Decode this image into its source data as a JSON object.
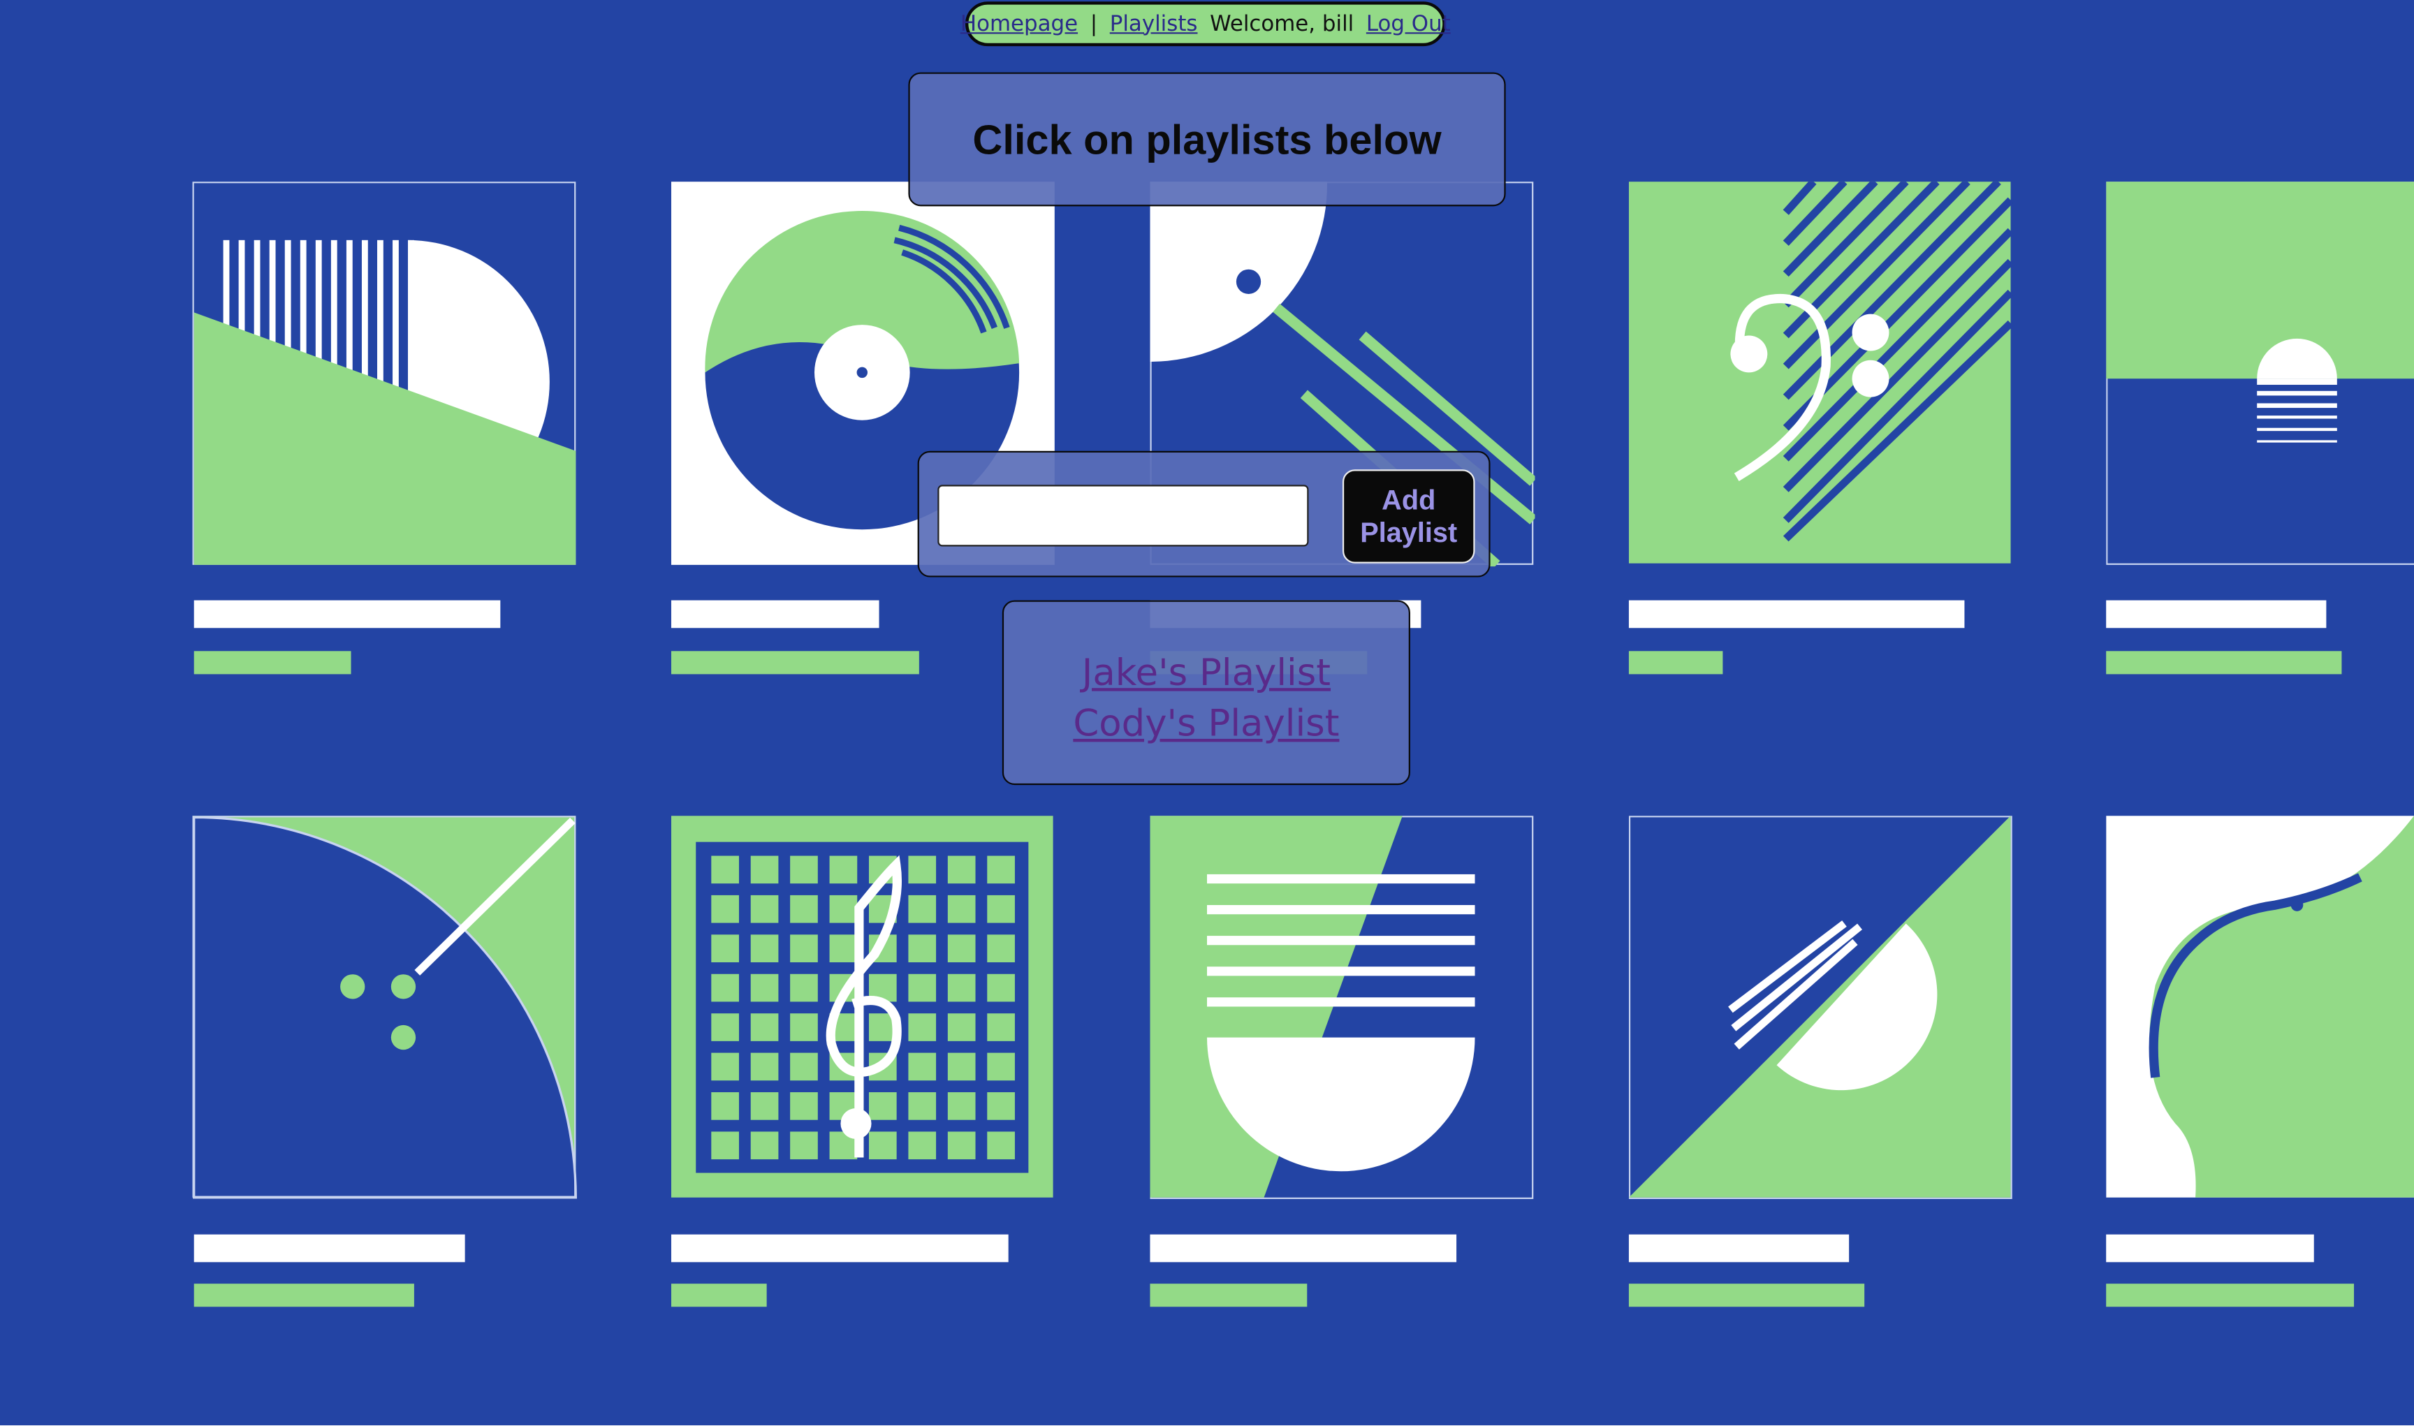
{
  "nav": {
    "homepage": "Homepage",
    "separator": "|",
    "playlists": "Playlists",
    "welcome": "Welcome, bill",
    "logout": "Log Out"
  },
  "title": "Click on playlists below",
  "add_form": {
    "input_value": "",
    "button_label": "Add Playlist"
  },
  "playlists": [
    "Jake's Playlist",
    "Cody's Playlist"
  ],
  "colors": {
    "background": "#2344a4",
    "accent_green": "#93da87",
    "white": "#ffffff",
    "link_purple": "#5a2a8a",
    "button_text": "#9b93e6"
  },
  "album_art": [
    "stripes-half-circle",
    "vinyl-record",
    "dot-diagonal-lines",
    "bass-clef",
    "sunset",
    "quarter-circle-dots",
    "grid-treble-clef",
    "staff-lines-bowl",
    "diagonal-split-circle",
    "guitar-curve"
  ]
}
